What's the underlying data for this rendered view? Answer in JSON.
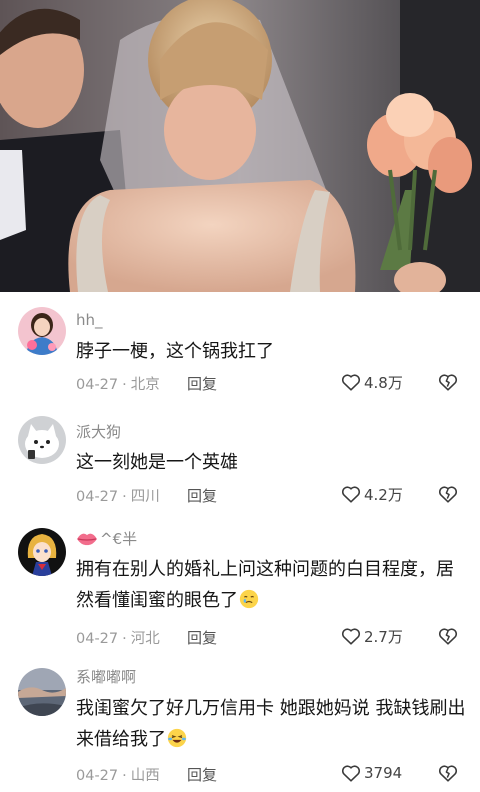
{
  "comments": [
    {
      "username": "hh_",
      "text": "脖子一梗，这个锅我扛了",
      "date": "04-27",
      "location": "北京",
      "reply_label": "回复",
      "likes": "4.8万",
      "avatar_icon": "girl-avatar"
    },
    {
      "username": "派大狗",
      "text": "这一刻她是一个英雄",
      "date": "04-27",
      "location": "四川",
      "reply_label": "回复",
      "likes": "4.2万",
      "avatar_icon": "cat-avatar"
    },
    {
      "username": "^€半",
      "username_icon": "lips-icon",
      "text": "拥有在别人的婚礼上问这种问题的白目程度，居然看懂闺蜜的眼色了",
      "text_emoji": "crying-face-emoji",
      "date": "04-27",
      "location": "河北",
      "reply_label": "回复",
      "likes": "2.7万",
      "avatar_icon": "anime-girl-avatar"
    },
    {
      "username": "系嘟嘟啊",
      "text": "我闺蜜欠了好几万信用卡 她跟她妈说 我缺钱刷出来借给我了",
      "text_emoji": "laughing-crying-emoji",
      "date": "04-27",
      "location": "山西",
      "reply_label": "回复",
      "likes": "3794",
      "avatar_icon": "landscape-avatar"
    }
  ],
  "colors": {
    "username": "#8a8a8a",
    "text": "#161616",
    "meta": "#9a9a9a"
  }
}
